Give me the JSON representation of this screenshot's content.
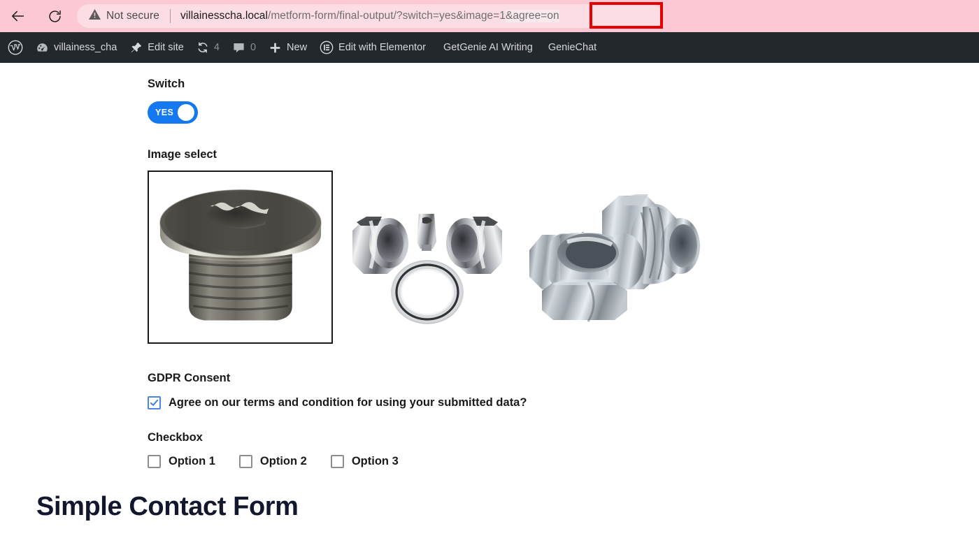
{
  "browser": {
    "back_icon": "back-arrow-icon",
    "reload_icon": "reload-icon",
    "security_icon": "warning-triangle-icon",
    "security_label": "Not secure",
    "url_host": "villainesscha.local",
    "url_path": "/metform-form/final-output/?switch=yes&image=1",
    "url_highlight": "&agree=on",
    "highlight_color": "#e60000",
    "toolbar_color": "#fbc8d4"
  },
  "admin_bar": {
    "background": "#23282d",
    "items": [
      {
        "label": "",
        "icon": "wordpress-logo-icon"
      },
      {
        "label": "villainess_cha",
        "icon": "dashboard-gauge-icon"
      },
      {
        "label": "Edit site",
        "icon": "pushpin-icon"
      },
      {
        "label": "4",
        "icon": "updates-refresh-icon"
      },
      {
        "label": "0",
        "icon": "comment-bubble-icon"
      },
      {
        "label": "New",
        "icon": "plus-icon"
      },
      {
        "label": "Edit with Elementor",
        "icon": "elementor-icon"
      },
      {
        "label": "GetGenie AI Writing",
        "icon": ""
      },
      {
        "label": "GenieChat",
        "icon": ""
      }
    ]
  },
  "form": {
    "switch": {
      "label": "Switch",
      "value": "YES",
      "on": true,
      "accent": "#1478f0"
    },
    "image_select": {
      "label": "Image select",
      "options": [
        {
          "alt": "threaded-plug-torx-head",
          "selected": true
        },
        {
          "alt": "hex-bushings-clip-ring",
          "selected": false
        },
        {
          "alt": "jic-flare-fittings",
          "selected": false
        }
      ]
    },
    "gdpr": {
      "label": "GDPR Consent",
      "consent_text": "Agree on our terms and condition for using your submitted data?",
      "checked": true,
      "accent": "#4a86e8"
    },
    "checkbox_group": {
      "label": "Checkbox",
      "options": [
        {
          "label": "Option 1",
          "checked": false
        },
        {
          "label": "Option 2",
          "checked": false
        },
        {
          "label": "Option 3",
          "checked": false
        }
      ]
    }
  },
  "next_section": {
    "heading": "Simple Contact Form",
    "heading_color": "#12172e"
  }
}
